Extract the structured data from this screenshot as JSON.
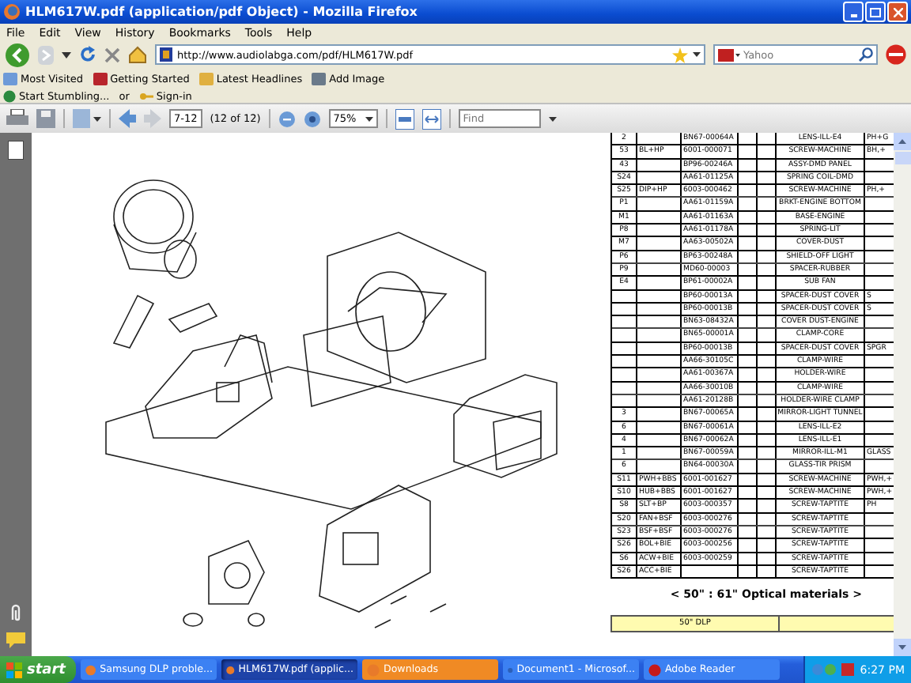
{
  "window": {
    "title": "HLM617W.pdf (application/pdf Object) - Mozilla Firefox"
  },
  "menu": [
    "File",
    "Edit",
    "View",
    "History",
    "Bookmarks",
    "Tools",
    "Help"
  ],
  "address": {
    "value": "http://www.audiolabga.com/pdf/HLM617W.pdf"
  },
  "search": {
    "placeholder": "Yahoo"
  },
  "bookmarks": [
    "Most Visited",
    "Getting Started",
    "Latest Headlines",
    "Add Image"
  ],
  "stumble": {
    "start": "Start Stumbling...",
    "or": "or",
    "sign_in": "Sign-in"
  },
  "pdf_toolbar": {
    "page": "7-12",
    "page_count": "(12 of 12)",
    "zoom": "75%",
    "find_placeholder": "Find"
  },
  "parts_table": {
    "rows": [
      {
        "column_1": "2",
        "column_3": "BN67-00064A",
        "column_6": "LENS-ILL-E4",
        "column_7": "PH+G"
      },
      {
        "column_1": "53",
        "column_2": "BL+HP",
        "column_3": "6001-000071",
        "column_6": "SCREW-MACHINE",
        "column_7": "BH,+"
      },
      {
        "column_1": "43",
        "column_3": "BP96-00246A",
        "column_6": "ASSY-DMD PANEL"
      },
      {
        "column_1": "S24",
        "column_3": "AA61-01125A",
        "column_6": "SPRING COIL-DMD"
      },
      {
        "column_1": "S25",
        "column_2": "DIP+HP",
        "column_3": "6003-000462",
        "column_6": "SCREW-MACHINE",
        "column_7": "PH,+"
      },
      {
        "column_1": "P1",
        "column_3": "AA61-01159A",
        "column_6": "BRKT-ENGINE BOTTOM"
      },
      {
        "column_1": "M1",
        "column_3": "AA61-01163A",
        "column_6": "BASE-ENGINE"
      },
      {
        "column_1": "P8",
        "column_3": "AA61-01178A",
        "column_6": "SPRING-LIT"
      },
      {
        "column_1": "M7",
        "column_3": "AA63-00502A",
        "column_6": "COVER-DUST"
      },
      {
        "column_1": "P6",
        "column_3": "BP63-00248A",
        "column_6": "SHIELD-OFF LIGHT"
      },
      {
        "column_1": "P9",
        "column_3": "MD60-00003",
        "column_6": "SPACER-RUBBER"
      },
      {
        "column_1": "E4",
        "column_3": "BP61-00002A",
        "column_6": "SUB FAN"
      },
      {
        "column_3": "BP60-00013A",
        "column_6": "SPACER-DUST COVER",
        "column_7": "S"
      },
      {
        "column_3": "BP60-00013B",
        "column_6": "SPACER-DUST COVER",
        "column_7": "S"
      },
      {
        "column_3": "BN63-08432A",
        "column_6": "COVER DUST-ENGINE"
      },
      {
        "column_3": "BN65-00001A",
        "column_6": "CLAMP-CORE"
      },
      {
        "column_3": "BP60-00013B",
        "column_6": "SPACER-DUST COVER",
        "column_7": "SPGR"
      },
      {
        "column_3": "AA66-30105C",
        "column_6": "CLAMP-WIRE"
      },
      {
        "column_3": "AA61-00367A",
        "column_6": "HOLDER-WIRE"
      },
      {
        "column_3": "AA66-30010B",
        "column_6": "CLAMP-WIRE"
      },
      {
        "column_3": "AA61-20128B",
        "column_6": "HOLDER-WIRE CLAMP"
      },
      {
        "column_1": "3",
        "column_3": "BN67-00065A",
        "column_6": "MIRROR-LIGHT TUNNEL"
      },
      {
        "column_1": "6",
        "column_3": "BN67-00061A",
        "column_6": "LENS-ILL-E2"
      },
      {
        "column_1": "4",
        "column_3": "BN67-00062A",
        "column_6": "LENS-ILL-E1"
      },
      {
        "column_1": "1",
        "column_3": "BN67-00059A",
        "column_6": "MIRROR-ILL-M1",
        "column_7": "GLASS"
      },
      {
        "column_1": "6",
        "column_3": "BN64-00030A",
        "column_6": "GLASS-TIR PRISM"
      },
      {
        "column_1": "S11",
        "column_2": "PWH+BBS",
        "column_3": "6001-001627",
        "column_6": "SCREW-MACHINE",
        "column_7": "PWH,+"
      },
      {
        "column_1": "S10",
        "column_2": "HUB+BBS",
        "column_3": "6001-001627",
        "column_6": "SCREW-MACHINE",
        "column_7": "PWH,+"
      },
      {
        "column_1": "S8",
        "column_2": "SLT+BP",
        "column_3": "6003-000357",
        "column_6": "SCREW-TAPTITE",
        "column_7": "PH"
      },
      {
        "column_1": "S20",
        "column_2": "FAN+BSF",
        "column_3": "6003-000276",
        "column_6": "SCREW-TAPTITE"
      },
      {
        "column_1": "S23",
        "column_2": "BSF+BSF",
        "column_3": "6003-000276",
        "column_6": "SCREW-TAPTITE"
      },
      {
        "column_1": "S26",
        "column_2": "BOL+BIE",
        "column_3": "6003-000256",
        "column_6": "SCREW-TAPTITE"
      },
      {
        "column_1": "S6",
        "column_2": "ACW+BIE",
        "column_3": "6003-000259",
        "column_6": "SCREW-TAPTITE"
      },
      {
        "column_1": "S26",
        "column_2": "ACC+BIE",
        "column_6": "SCREW-TAPTITE"
      }
    ]
  },
  "section_title": "< 50\" : 61\" Optical materials >",
  "subtable_header": "50\" DLP",
  "taskbar": {
    "start": "start",
    "clock": "6:27 PM",
    "tasks": [
      {
        "label": "Samsung DLP proble...",
        "selected": false,
        "flashing": false
      },
      {
        "label": "HLM617W.pdf (applic...",
        "selected": true,
        "flashing": false
      },
      {
        "label": "Downloads",
        "selected": false,
        "flashing": true
      },
      {
        "label": "Document1 - Microsof...",
        "selected": false,
        "flashing": false
      },
      {
        "label": "Adobe Reader",
        "selected": false,
        "flashing": false
      }
    ]
  }
}
